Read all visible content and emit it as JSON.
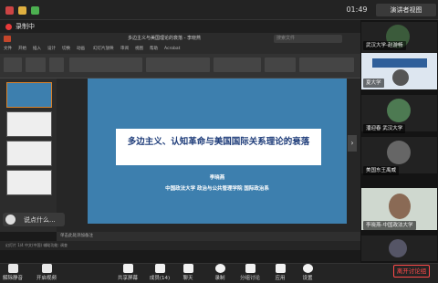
{
  "window": {
    "time": "01:49",
    "view_button": "演讲者视图"
  },
  "recording": {
    "label": "录制中"
  },
  "ppt": {
    "title": "多边主义与美国理论的衰落 - 李晓燕",
    "search_placeholder": "搜索文件",
    "tabs": [
      "文件",
      "开始",
      "插入",
      "设计",
      "切换",
      "动画",
      "幻灯片放映",
      "审阅",
      "视图",
      "帮助",
      "Acrobat"
    ],
    "notes": "单击此处添加备注",
    "status": "幻灯片 1/4  中文(中国)  辅助功能: 调查"
  },
  "slide": {
    "title": "多边主义、认知革命与美国国际关系理论的衰落",
    "author": "李晓燕",
    "affiliation": "中国政法大学 政治与公共管理学院 国际政治系"
  },
  "chat": {
    "placeholder": "说点什么..."
  },
  "participants": [
    {
      "name": "武汉大学-赵游畅"
    },
    {
      "name": "夏大学"
    },
    {
      "name": "潘迎春 武汉大学"
    },
    {
      "name": "美国东王禹威"
    },
    {
      "name": "李晓燕-中国政法大学"
    }
  ],
  "toolbar": {
    "items": [
      "解除静音",
      "开启视频",
      "共享屏幕",
      "成员(14)",
      "聊天",
      "录制",
      "分组讨论",
      "应用",
      "设置"
    ],
    "leave": "离开讨论组"
  },
  "colors": {
    "slide_bg": "#3d7fae",
    "title_color": "#1f3d7a",
    "leave": "#ff4a4a",
    "rec": "#e83a3a"
  }
}
